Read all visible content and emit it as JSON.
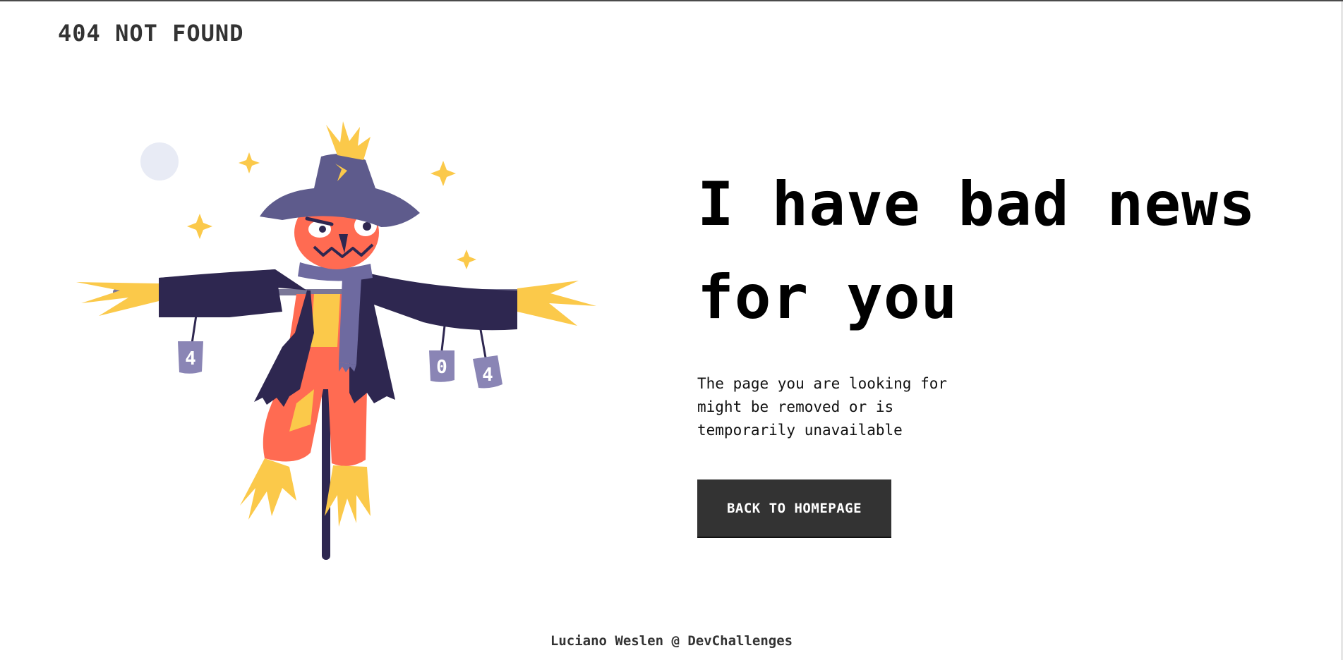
{
  "brand": {
    "title": "404 NOT FOUND"
  },
  "illustration": {
    "name": "scarecrow-illustration",
    "cans": [
      "4",
      "0",
      "4"
    ],
    "colors": {
      "hat": "#5e5b8c",
      "coat": "#2e2750",
      "body": "#ff6b52",
      "straw": "#fbc94a",
      "scarf": "#6e6aa0",
      "can": "#8a85b5",
      "moon": "#e8ebf5",
      "pole": "#2e2750"
    }
  },
  "main": {
    "headline": "I have bad news for you",
    "message": "The page you are looking for might be removed or is temporarily unavailable",
    "button_label": "BACK TO HOMEPAGE"
  },
  "footer": {
    "credit": "Luciano Weslen @ DevChallenges"
  },
  "theme": {
    "button_bg": "#333333",
    "text": "#000000"
  }
}
